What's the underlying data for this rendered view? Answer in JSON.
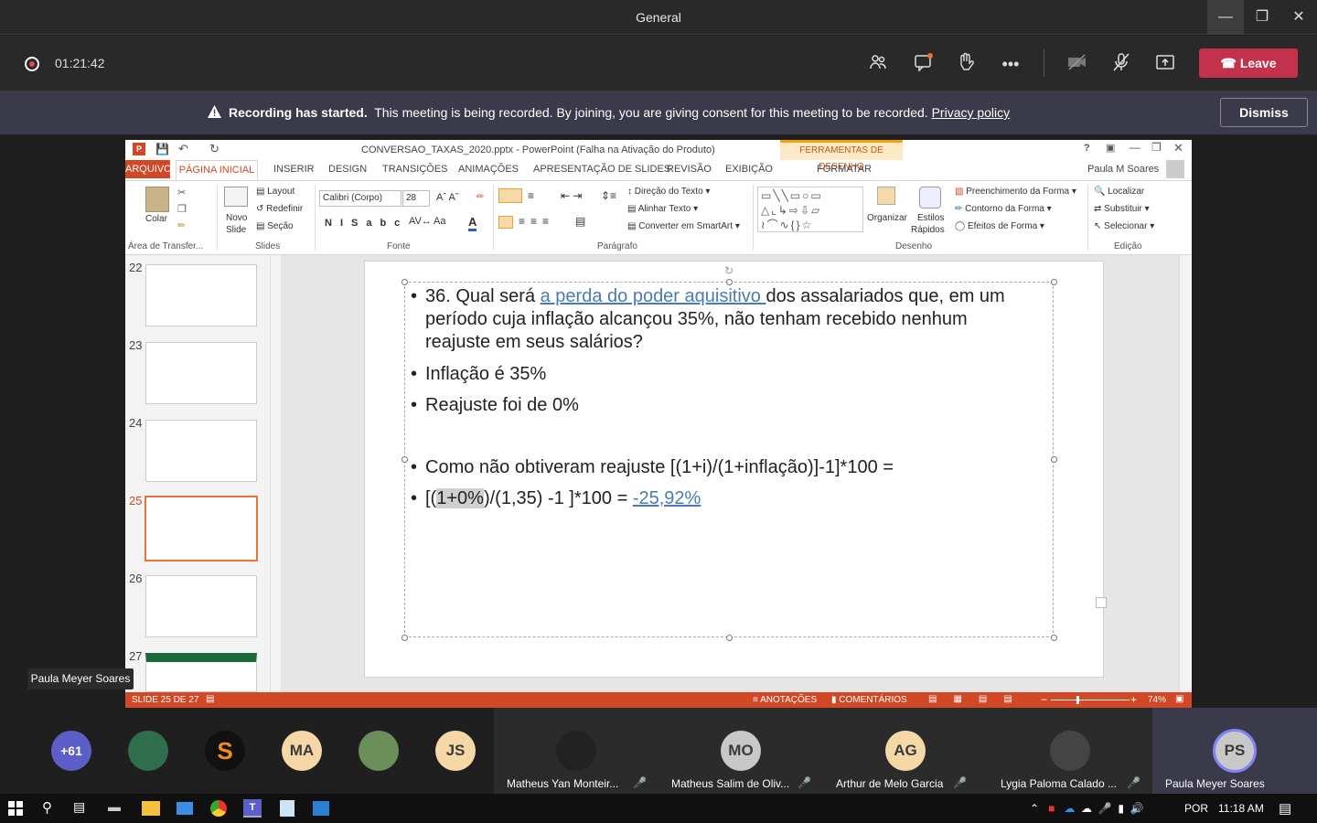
{
  "window": {
    "title": "General"
  },
  "meeting": {
    "timer": "01:21:42",
    "leave_label": "Leave"
  },
  "banner": {
    "bold": "Recording has started.",
    "text": "This meeting is being recorded. By joining, you are giving consent for this meeting to be recorded.",
    "link": "Privacy policy",
    "dismiss": "Dismiss"
  },
  "ppt": {
    "title": "CONVERSAO_TAXAS_2020.pptx - PowerPoint (Falha na Ativação do Produto)",
    "contextual_tab": "FERRAMENTAS DE DESENHO",
    "user": "Paula M Soares",
    "tabs": [
      "ARQUIVO",
      "PÁGINA INICIAL",
      "INSERIR",
      "DESIGN",
      "TRANSIÇÕES",
      "ANIMAÇÕES",
      "APRESENTAÇÃO DE SLIDES",
      "REVISÃO",
      "EXIBIÇÃO",
      "FORMATAR"
    ],
    "ribbon": {
      "colar": "Colar",
      "novo": "Novo",
      "slide": "Slide",
      "layout": "Layout",
      "redefinir": "Redefinir",
      "secao": "Seção",
      "font_name": "Calibri (Corpo)",
      "font_size": "28",
      "direcao": "Direção do Texto",
      "alinhar": "Alinhar Texto",
      "converter": "Converter em SmartArt",
      "organizar": "Organizar",
      "estilos": "Estilos",
      "rapidos": "Rápidos",
      "preench": "Preenchimento da Forma",
      "contorno": "Contorno da Forma",
      "efeitos": "Efeitos de Forma",
      "localizar": "Localizar",
      "substituir": "Substituir",
      "selecionar": "Selecionar",
      "groups": [
        "Área de Transfer...",
        "Slides",
        "Fonte",
        "Parágrafo",
        "Desenho",
        "Edição"
      ]
    },
    "thumbnails": [
      "22",
      "23",
      "24",
      "25",
      "26",
      "27"
    ],
    "selected_slide": "25",
    "slide": {
      "b1_pre": "36. Qual será ",
      "b1_link": "a perda do poder aquisitivo ",
      "b1_post": "dos assalariados que, em um",
      "b1_l2": "período cuja inflação alcançou 35%, não tenham recebido nenhum",
      "b1_l3": "reajuste em seus salários?",
      "b2": "Inflação é 35%",
      "b3": "Reajuste foi de 0%",
      "b4": "Como não obtiveram reajuste [(1+i)/(1+inflação)]-1]*100 =",
      "b5_pre": "[(",
      "b5_sel": "1+0%",
      "b5_mid": ")/(1,35) -1 ]*100 = ",
      "b5_link": "-25,92%"
    },
    "status": {
      "slide_of": "SLIDE 25 DE 27",
      "anotacoes": "ANOTAÇÕES",
      "comentarios": "COMENTÁRIOS",
      "zoom": "74%"
    }
  },
  "presenter_label": "Paula Meyer Soares",
  "participants": {
    "more": "+61",
    "avatars": [
      "MA",
      "JS"
    ],
    "tiles": [
      {
        "name": "Matheus Yan Monteir...",
        "initials": ""
      },
      {
        "name": "Matheus Salim de Oliv...",
        "initials": "MO"
      },
      {
        "name": "Arthur de Melo Garcia",
        "initials": "AG"
      },
      {
        "name": "Lygia Paloma Calado ...",
        "initials": ""
      },
      {
        "name": "Paula Meyer Soares",
        "initials": "PS"
      }
    ]
  },
  "taskbar": {
    "lang": "POR",
    "time": "11:18 AM"
  }
}
